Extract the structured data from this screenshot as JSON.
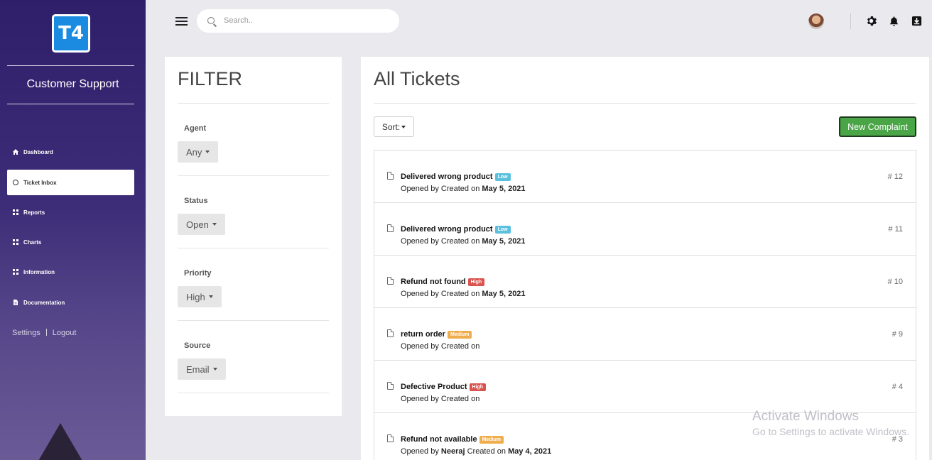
{
  "sidebar": {
    "logo_text": "T4",
    "brand": "Customer Support",
    "items": [
      {
        "label": "Dashboard",
        "icon": "home-icon"
      },
      {
        "label": "Ticket Inbox",
        "icon": "inbox-icon"
      },
      {
        "label": "Reports",
        "icon": "grid-icon"
      },
      {
        "label": "Charts",
        "icon": "grid-icon"
      },
      {
        "label": "Information",
        "icon": "info-grid-icon"
      },
      {
        "label": "Documentation",
        "icon": "document-icon"
      }
    ],
    "active_item": "Ticket Inbox",
    "settings_label": "Settings",
    "logout_label": "Logout"
  },
  "topbar": {
    "search_placeholder": "Search..",
    "icons": [
      "menu-icon",
      "search-icon",
      "avatar",
      "gear-icon",
      "bell-icon",
      "download-icon"
    ]
  },
  "filter": {
    "title": "FILTER",
    "groups": [
      {
        "label": "Agent",
        "value": "Any"
      },
      {
        "label": "Status",
        "value": "Open"
      },
      {
        "label": "Priority",
        "value": "High"
      },
      {
        "label": "Source",
        "value": "Email"
      }
    ]
  },
  "tickets": {
    "title": "All Tickets",
    "sort_label": "Sort:",
    "new_button": "New Complaint",
    "rows": [
      {
        "subject": "Delivered wrong product",
        "priority": "Low",
        "priority_class": "low",
        "meta_prefix": "Opened by",
        "agent": "",
        "meta_mid": "Created on",
        "date": "May 5, 2021",
        "number": "# 12"
      },
      {
        "subject": "Delivered wrong product",
        "priority": "Low",
        "priority_class": "low",
        "meta_prefix": "Opened by",
        "agent": "",
        "meta_mid": "Created on",
        "date": "May 5, 2021",
        "number": "# 11"
      },
      {
        "subject": "Refund not found",
        "priority": "High",
        "priority_class": "high",
        "meta_prefix": "Opened by",
        "agent": "",
        "meta_mid": "Created on",
        "date": "May 5, 2021",
        "number": "# 10"
      },
      {
        "subject": "return order",
        "priority": "Medium",
        "priority_class": "medium",
        "meta_prefix": "Opened by",
        "agent": "",
        "meta_mid": "Created on",
        "date": "",
        "number": "# 9"
      },
      {
        "subject": "Defective Product",
        "priority": "High",
        "priority_class": "high",
        "meta_prefix": "Opened by",
        "agent": "",
        "meta_mid": "Created on",
        "date": "",
        "number": "# 4"
      },
      {
        "subject": "Refund not available",
        "priority": "Medium",
        "priority_class": "medium",
        "meta_prefix": "Opened by",
        "agent": "Neeraj",
        "meta_mid": "Created on",
        "date": "May 4, 2021",
        "number": "# 3"
      }
    ]
  },
  "watermark": {
    "line1": "Activate Windows",
    "line2": "Go to Settings to activate Windows."
  },
  "colors": {
    "sidebar_top": "#2f1f6b",
    "sidebar_bottom": "#6a5a96",
    "new_button": "#4aa547",
    "low": "#5bc0de",
    "high": "#d9534f",
    "medium": "#f0ad4e"
  }
}
